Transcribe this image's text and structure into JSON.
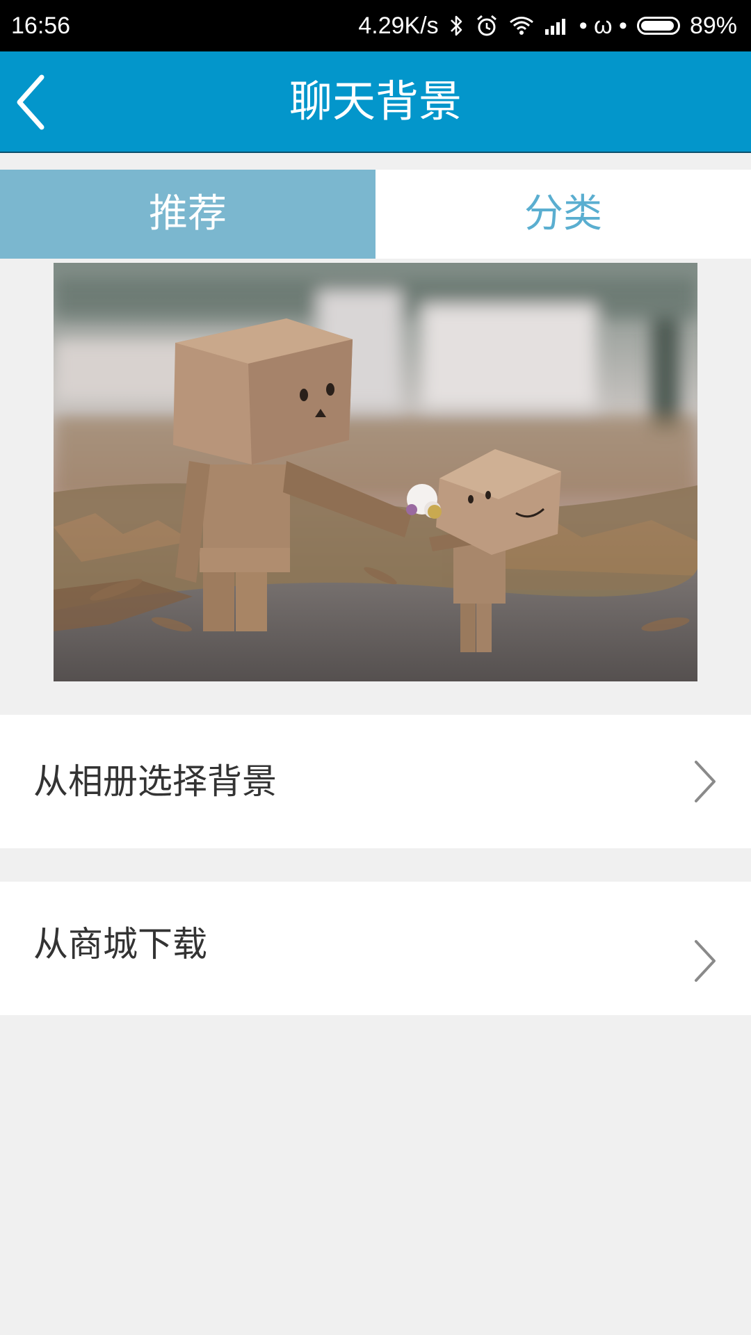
{
  "status_bar": {
    "time": "16:56",
    "net_speed": "4.29K/s",
    "icons": [
      "bluetooth-icon",
      "alarm-icon",
      "wifi-icon",
      "signal-icon",
      "dots-icon",
      "battery-icon"
    ],
    "omega": "• ω •",
    "battery_percent": "89%"
  },
  "header": {
    "title": "聊天背景",
    "back_icon": "chevron-left-icon",
    "bg_color": "#0396cb"
  },
  "tabs": [
    {
      "label": "推荐",
      "selected": true
    },
    {
      "label": "分类",
      "selected": false
    }
  ],
  "preview": {
    "description_icon": "danbo-photo"
  },
  "menu": [
    {
      "label": "从相册选择背景",
      "icon": "chevron-right-icon"
    },
    {
      "label": "从商城下载",
      "icon": "chevron-right-icon"
    }
  ],
  "colors": {
    "tab_selected_bg": "#7bb7cf",
    "tab_unselected_text": "#5aaed0",
    "page_bg": "#f0f0f0"
  }
}
